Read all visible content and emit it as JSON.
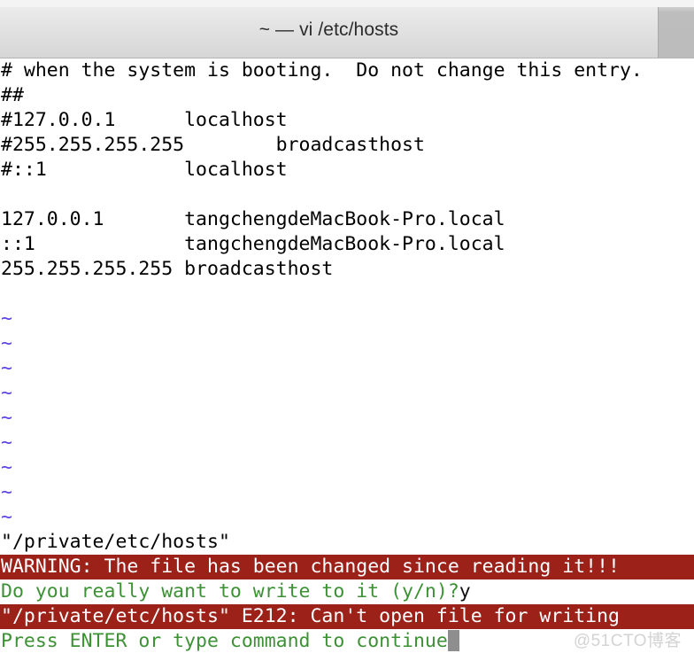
{
  "window": {
    "title": "~ — vi /etc/hosts"
  },
  "terminal": {
    "lines": [
      {
        "text": "# when the system is booting.  Do not change this entry.",
        "style": "plain"
      },
      {
        "text": "##",
        "style": "plain"
      },
      {
        "text": "#127.0.0.1      localhost",
        "style": "plain"
      },
      {
        "text": "#255.255.255.255        broadcasthost",
        "style": "plain"
      },
      {
        "text": "#::1            localhost",
        "style": "plain"
      },
      {
        "text": "",
        "style": "blank"
      },
      {
        "text": "127.0.0.1       tangchengdeMacBook-Pro.local",
        "style": "plain"
      },
      {
        "text": "::1             tangchengdeMacBook-Pro.local",
        "style": "plain"
      },
      {
        "text": "255.255.255.255 broadcasthost",
        "style": "plain"
      },
      {
        "text": "",
        "style": "blank"
      },
      {
        "text": "~",
        "style": "tilde"
      },
      {
        "text": "~",
        "style": "tilde"
      },
      {
        "text": "~",
        "style": "tilde"
      },
      {
        "text": "~",
        "style": "tilde"
      },
      {
        "text": "~",
        "style": "tilde"
      },
      {
        "text": "~",
        "style": "tilde"
      },
      {
        "text": "~",
        "style": "tilde"
      },
      {
        "text": "~",
        "style": "tilde"
      },
      {
        "text": "~",
        "style": "tilde"
      }
    ],
    "messages": {
      "filename_line": "\"/private/etc/hosts\"",
      "warning_line": "WARNING: The file has been changed since reading it!!!",
      "prompt_line": "Do you really want to write to it (y/n)?",
      "prompt_answer": "y",
      "error_line": "\"/private/etc/hosts\" E212: Can't open file for writing",
      "continue_line": "Press ENTER or type command to continue"
    }
  },
  "watermark": {
    "text": "@51CTO博客"
  },
  "colors": {
    "warning_background": "#9b2119",
    "warning_text": "#ffffff",
    "prompt_text": "#3d9135",
    "tilde_text": "#5b44e0",
    "cursor": "#8e8e8e",
    "terminal_background": "#ffffff",
    "terminal_text": "#000000",
    "titlebar_background": "#e2e2e2"
  }
}
